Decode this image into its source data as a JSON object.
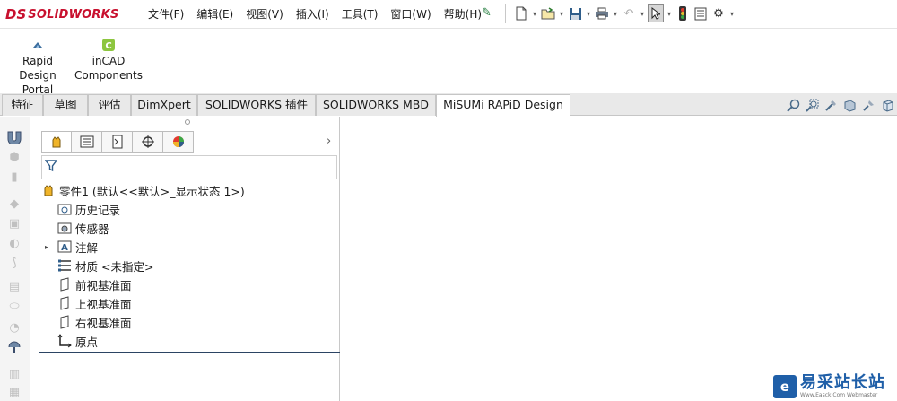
{
  "app": {
    "logo_prefix": "DS",
    "logo_name": "SOLIDWORKS"
  },
  "menu": [
    "文件(F)",
    "编辑(E)",
    "视图(V)",
    "插入(I)",
    "工具(T)",
    "窗口(W)",
    "帮助(H)"
  ],
  "toolbar": {
    "icons": [
      "new-document-icon",
      "open-folder-icon",
      "save-icon",
      "print-icon",
      "undo-icon",
      "select-arrow-icon",
      "rebuild-traffic-light-icon",
      "file-properties-icon",
      "options-gear-icon"
    ]
  },
  "ribbon": {
    "buttons": [
      {
        "line1": "Rapid Design",
        "line2": "Portal"
      },
      {
        "line1": "inCAD",
        "line2": "Components"
      }
    ]
  },
  "tabs": [
    "特征",
    "草图",
    "评估",
    "DimXpert",
    "SOLIDWORKS 插件",
    "SOLIDWORKS MBD",
    "MiSUMi RAPiD Design"
  ],
  "active_tab": "MiSUMi RAPiD Design",
  "feature_tree": {
    "root": "零件1  (默认<<默认>_显示状态 1>)",
    "items": [
      {
        "label": "历史记录",
        "icon": "history-folder-icon",
        "expandable": false
      },
      {
        "label": "传感器",
        "icon": "sensor-folder-icon",
        "expandable": false
      },
      {
        "label": "注解",
        "icon": "annotations-icon",
        "expandable": true
      },
      {
        "label": "材质 <未指定>",
        "icon": "material-icon",
        "expandable": false
      },
      {
        "label": "前视基准面",
        "icon": "plane-icon",
        "expandable": false
      },
      {
        "label": "上视基准面",
        "icon": "plane-icon",
        "expandable": false
      },
      {
        "label": "右视基准面",
        "icon": "plane-icon",
        "expandable": false
      },
      {
        "label": "原点",
        "icon": "origin-icon",
        "expandable": false
      }
    ]
  },
  "watermark": {
    "cn": "易采站长站",
    "en": "Www.Easck.Com  Webmaster"
  }
}
